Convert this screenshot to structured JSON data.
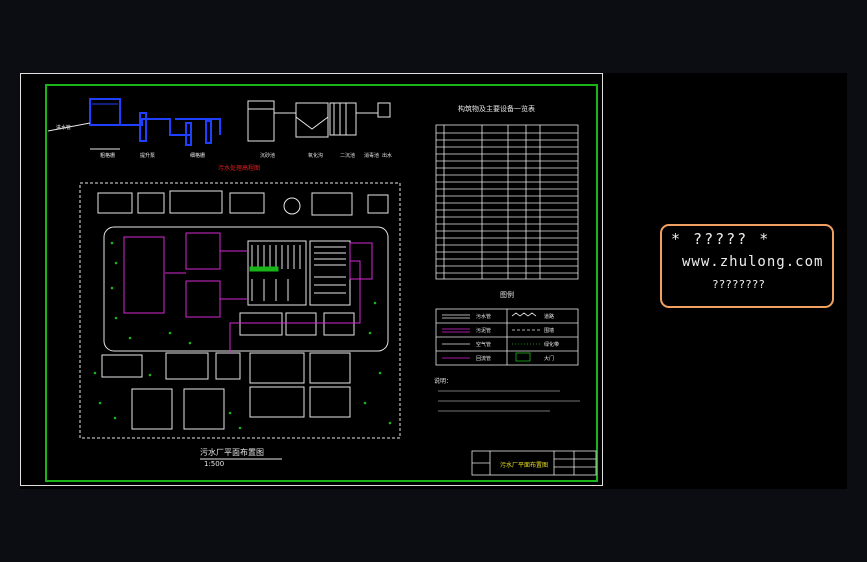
{
  "drawing": {
    "plan_title": "污水厂平面布置图",
    "plan_scale": "1:500",
    "equipment_table_title": "构筑物及主要设备一览表",
    "legend_title": "图例",
    "legend_items": [
      {
        "label": "污水管",
        "style": "white-double"
      },
      {
        "label": "污泥管",
        "style": "magenta-double"
      },
      {
        "label": "空气管",
        "style": "white-line"
      },
      {
        "label": "回流管",
        "style": "magenta-line"
      },
      {
        "label": "道路",
        "style": "white-wave"
      },
      {
        "label": "围墙",
        "style": "white-dash"
      },
      {
        "label": "绿化带",
        "style": "green-dots"
      },
      {
        "label": "大门",
        "style": "green-box"
      }
    ],
    "notes_heading": "说明：",
    "title_block_text": "污水厂平面布置图",
    "colors": {
      "white": "#e6e6e6",
      "green": "#18b418",
      "magenta": "#d428d4",
      "blue": "#2040ff",
      "red": "#e02020",
      "yellow": "#e8e020"
    }
  },
  "watermark": {
    "line1": "* ????? *",
    "line2": "www.zhulong.com",
    "line3": "????????"
  }
}
